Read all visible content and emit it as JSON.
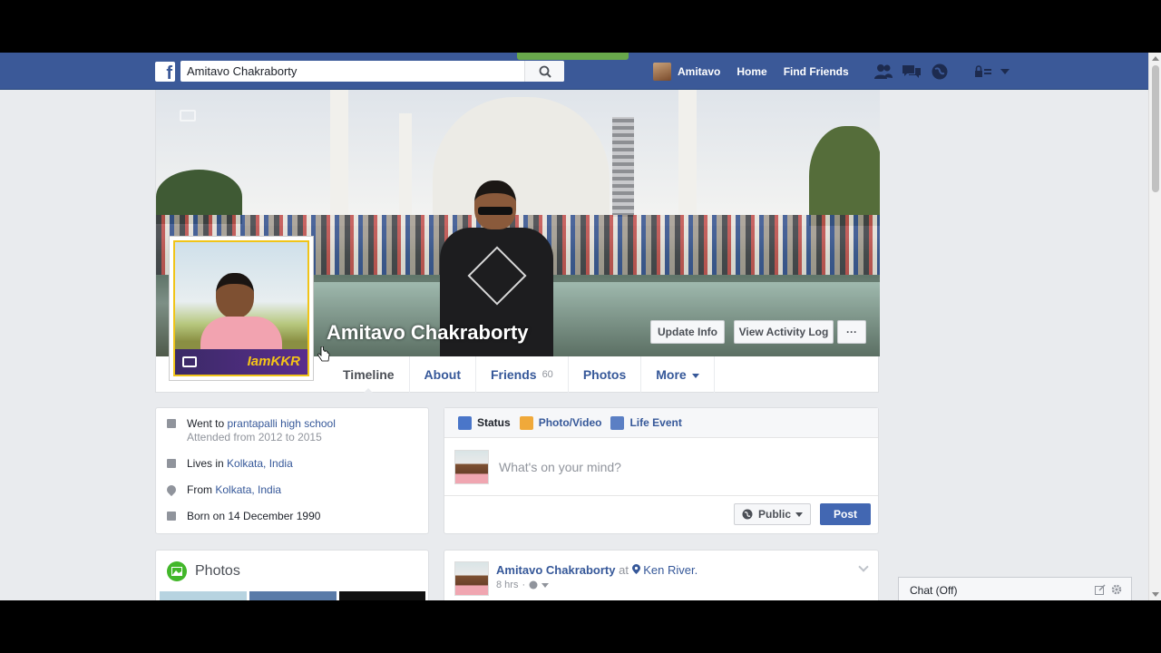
{
  "topbar": {
    "logo": "f",
    "search_value": "Amitavo Chakraborty",
    "user_name": "Amitavo",
    "home": "Home",
    "find_friends": "Find Friends"
  },
  "profile": {
    "name": "Amitavo Chakraborty",
    "update_info": "Update Info",
    "view_activity_log": "View Activity Log",
    "more_dots": "···",
    "avatar_badge": "IamKKR"
  },
  "tabs": [
    {
      "label": "Timeline",
      "count": ""
    },
    {
      "label": "About",
      "count": ""
    },
    {
      "label": "Friends",
      "count": "60"
    },
    {
      "label": "Photos",
      "count": ""
    },
    {
      "label": "More",
      "count": ""
    }
  ],
  "intro": {
    "school_prefix": "Went to ",
    "school": "prantapalli high school",
    "attended": "Attended from 2012 to 2015",
    "lives_prefix": "Lives in ",
    "lives": "Kolkata, India",
    "from_prefix": "From ",
    "from": "Kolkata, India",
    "born": "Born on 14 December 1990"
  },
  "photos": {
    "title": "Photos"
  },
  "composer": {
    "status": "Status",
    "photo_video": "Photo/Video",
    "life_event": "Life Event",
    "placeholder": "What's on your mind?",
    "audience": "Public",
    "post": "Post"
  },
  "story": {
    "author": "Amitavo Chakraborty",
    "at": "at",
    "place": "Ken River.",
    "time": "8 hrs"
  },
  "chat": {
    "label": "Chat (Off)"
  },
  "colors": {
    "brand": "#3b5998",
    "link": "#365899",
    "post_button": "#4267b2"
  }
}
